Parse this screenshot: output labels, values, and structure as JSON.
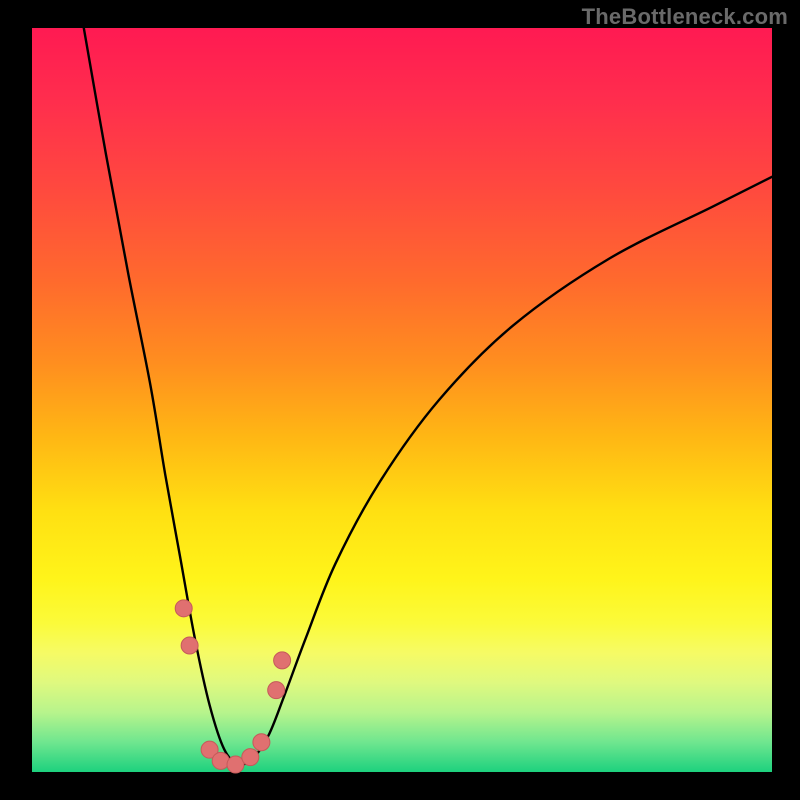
{
  "watermark": {
    "text": "TheBottleneck.com"
  },
  "colors": {
    "frame": "#000000",
    "watermark": "#6a6a6a",
    "curve_stroke": "#000000",
    "marker_fill": "#e07070",
    "marker_stroke": "#c55a5a",
    "gradient_stops": [
      "#ff1a52",
      "#ff2e4d",
      "#ff4a3e",
      "#ff6a2d",
      "#ff8e1f",
      "#ffb714",
      "#ffe012",
      "#fff41a",
      "#fbfb3a",
      "#f6fb65",
      "#dff97f",
      "#b7f48c",
      "#6fe68f",
      "#1dd17e"
    ]
  },
  "chart_data": {
    "type": "line",
    "title": "",
    "xlabel": "",
    "ylabel": "",
    "xlim": [
      0,
      100
    ],
    "ylim": [
      0,
      100
    ],
    "grid": false,
    "legend": false,
    "notes": "Bottleneck-shaped V curve over a rainbow gradient background. y≈100 means high bottleneck (top/red), y≈0 means low bottleneck (bottom/green). Minimum near x≈27.",
    "series": [
      {
        "name": "bottleneck-curve",
        "x": [
          7,
          10,
          13,
          16,
          18,
          20,
          22,
          24,
          26,
          28,
          30,
          32,
          34,
          37,
          41,
          47,
          55,
          65,
          78,
          92,
          100
        ],
        "y": [
          100,
          83,
          67,
          52,
          40,
          29,
          18,
          9,
          3,
          1,
          2,
          5,
          10,
          18,
          28,
          39,
          50,
          60,
          69,
          76,
          80
        ]
      }
    ],
    "markers": [
      {
        "x": 20.5,
        "y": 22
      },
      {
        "x": 21.3,
        "y": 17
      },
      {
        "x": 24.0,
        "y": 3
      },
      {
        "x": 25.5,
        "y": 1.5
      },
      {
        "x": 27.5,
        "y": 1
      },
      {
        "x": 29.5,
        "y": 2
      },
      {
        "x": 31.0,
        "y": 4
      },
      {
        "x": 33.0,
        "y": 11
      },
      {
        "x": 33.8,
        "y": 15
      }
    ]
  }
}
